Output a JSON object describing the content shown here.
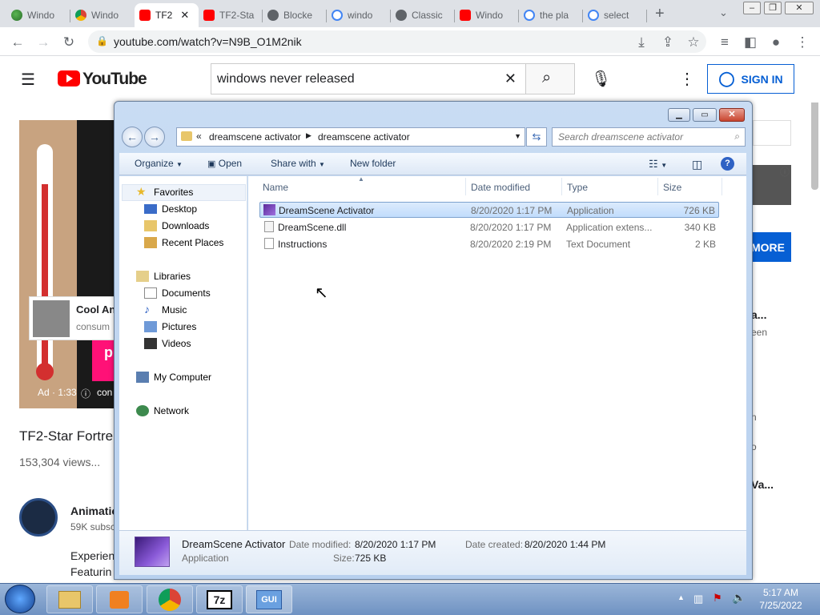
{
  "browser": {
    "tabs": [
      {
        "title": "Windo",
        "icon": "earth-icon"
      },
      {
        "title": "Windo",
        "icon": "chrome-icon"
      },
      {
        "title": "TF2",
        "icon": "youtube-icon"
      },
      {
        "title": "TF2-Sta",
        "icon": "youtube-icon"
      },
      {
        "title": "Blocke",
        "icon": "globe-icon"
      },
      {
        "title": "windo",
        "icon": "google-icon"
      },
      {
        "title": "Classic",
        "icon": "globe-icon"
      },
      {
        "title": "Windo",
        "icon": "youtube-icon"
      },
      {
        "title": "the pla",
        "icon": "google-icon"
      },
      {
        "title": "select",
        "icon": "google-icon"
      }
    ],
    "url": "youtube.com/watch?v=N9B_O1M2nik"
  },
  "youtube": {
    "logo_text": "YouTube",
    "search_value": "windows never released",
    "sign_in": "SIGN IN",
    "video_title": "TF2-Star Fortre",
    "views": "153,304 views...",
    "channel_name": "Animatio",
    "subscribers": "59K subsc",
    "description_1": "Experien",
    "description_2": "Featurin",
    "ad_label": "Ad · 1:33",
    "ad_info": "con",
    "ad_card_title": "Cool An",
    "ad_card_sub": "consum",
    "ad_pink_text": "p",
    "more_button": "MORE",
    "side_text_1": "a...",
    "side_text_2": "een",
    "side_text_3": "n",
    "side_text_4": "o",
    "side_text_5": "Va..."
  },
  "explorer": {
    "breadcrumb": [
      "dreamscene activator",
      "dreamscene activator"
    ],
    "search_placeholder": "Search dreamscene activator",
    "commands": {
      "organize": "Organize",
      "open": "Open",
      "share": "Share with",
      "new_folder": "New folder"
    },
    "nav": {
      "favorites": "Favorites",
      "desktop": "Desktop",
      "downloads": "Downloads",
      "recent": "Recent Places",
      "libraries": "Libraries",
      "documents": "Documents",
      "music": "Music",
      "pictures": "Pictures",
      "videos": "Videos",
      "computer": "My Computer",
      "network": "Network"
    },
    "columns": {
      "name": "Name",
      "date": "Date modified",
      "type": "Type",
      "size": "Size"
    },
    "files": [
      {
        "name": "DreamScene Activator",
        "date": "8/20/2020 1:17 PM",
        "type": "Application",
        "size": "726 KB"
      },
      {
        "name": "DreamScene.dll",
        "date": "8/20/2020 1:17 PM",
        "type": "Application extens...",
        "size": "340 KB"
      },
      {
        "name": "Instructions",
        "date": "8/20/2020 2:19 PM",
        "type": "Text Document",
        "size": "2 KB"
      }
    ],
    "details": {
      "name": "DreamScene Activator",
      "type": "Application",
      "modified_label": "Date modified:",
      "modified": "8/20/2020 1:17 PM",
      "size_label": "Size:",
      "size": "725 KB",
      "created_label": "Date created:",
      "created": "8/20/2020 1:44 PM"
    }
  },
  "taskbar": {
    "time": "5:17 AM",
    "date": "7/25/2022",
    "app_7z": "7z",
    "app_gui": "GUI"
  },
  "colors": {
    "youtube_red": "#ff0000",
    "link_blue": "#065fd4",
    "selection": "#cce4fc"
  }
}
